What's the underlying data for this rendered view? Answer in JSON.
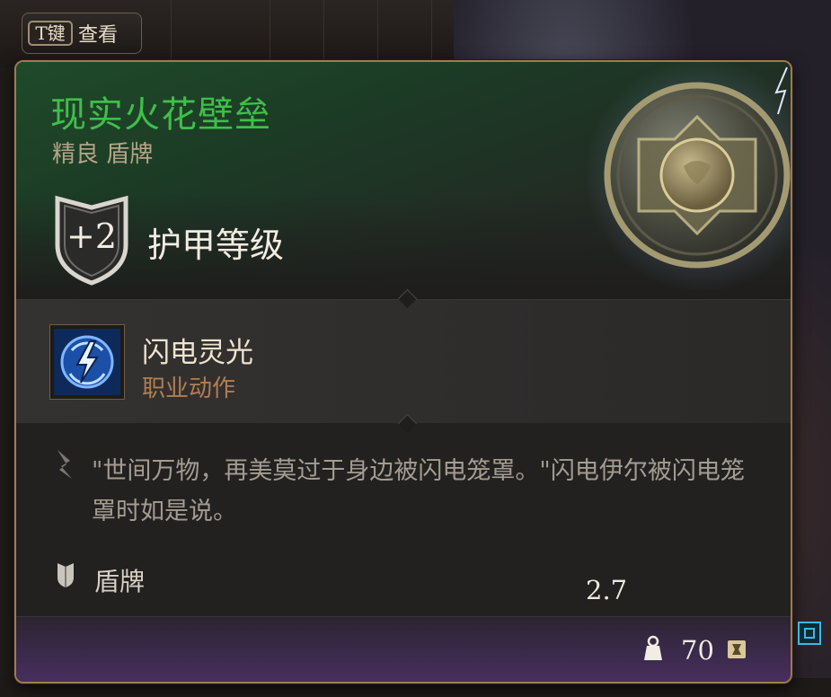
{
  "hotkey": {
    "key": "T键",
    "label": "查看"
  },
  "item": {
    "name": "现实火花壁垒",
    "subtitle": "精良 盾牌",
    "armor_bonus": "+2",
    "armor_label": "护甲等级"
  },
  "ability": {
    "name": "闪电灵光",
    "type": "职业动作",
    "icon": "lightning-rune-icon"
  },
  "description": "\"世间万物，再美莫过于身边被闪电笼罩。\"闪电伊尔被闪电笼罩时如是说。",
  "item_type": "盾牌",
  "footer": {
    "weight": "2.7",
    "value": "70"
  },
  "colors": {
    "rarity_uncommon": "#3fbf49",
    "border": "#9e7a52",
    "ability_type": "#b07f52"
  }
}
